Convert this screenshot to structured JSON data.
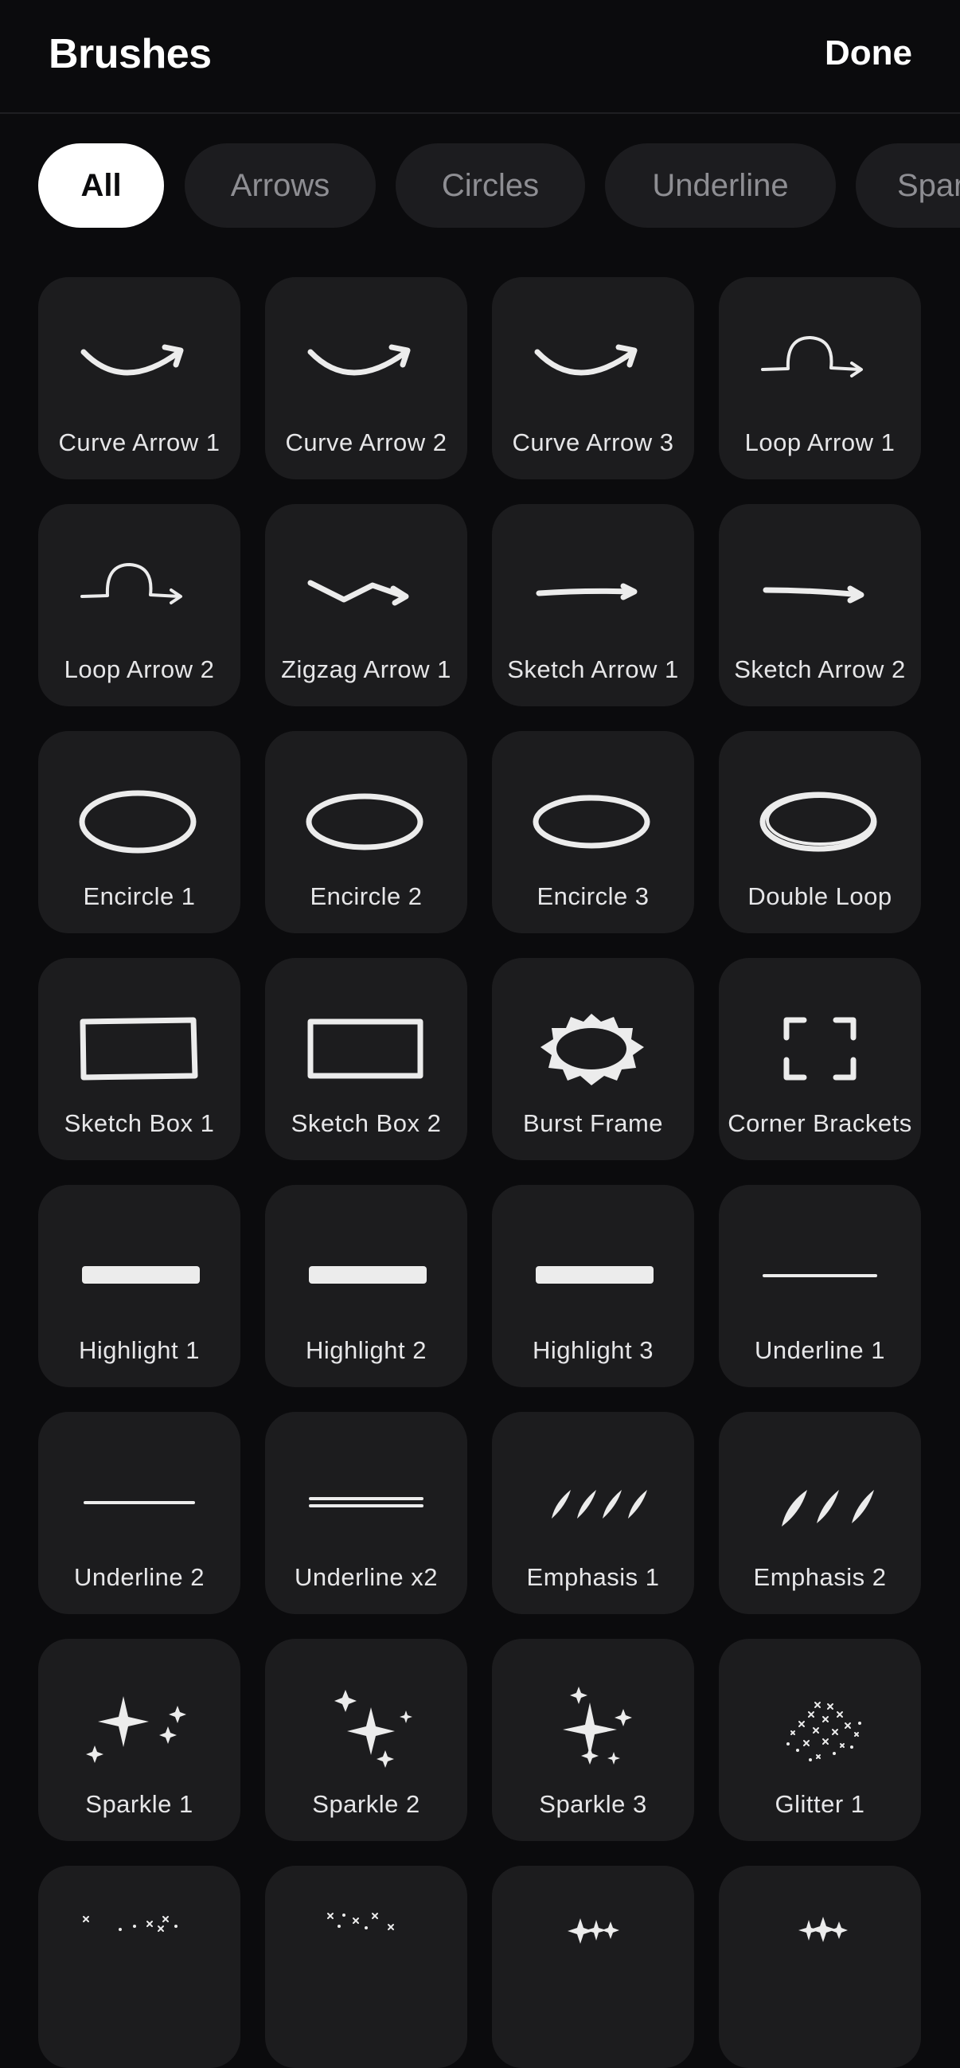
{
  "header": {
    "title": "Brushes",
    "done_label": "Done"
  },
  "filters": [
    {
      "label": "All",
      "active": true
    },
    {
      "label": "Arrows",
      "active": false
    },
    {
      "label": "Circles",
      "active": false
    },
    {
      "label": "Underline",
      "active": false
    },
    {
      "label": "Sparkles",
      "active": false
    }
  ],
  "brushes": [
    {
      "label": "Curve Arrow 1",
      "icon": "curve-arrow-icon"
    },
    {
      "label": "Curve Arrow 2",
      "icon": "curve-arrow-icon"
    },
    {
      "label": "Curve Arrow 3",
      "icon": "curve-arrow-icon"
    },
    {
      "label": "Loop Arrow 1",
      "icon": "loop-arrow-icon"
    },
    {
      "label": "Loop Arrow 2",
      "icon": "loop-arrow-icon"
    },
    {
      "label": "Zigzag Arrow 1",
      "icon": "zigzag-arrow-icon"
    },
    {
      "label": "Sketch Arrow 1",
      "icon": "sketch-arrow-icon"
    },
    {
      "label": "Sketch Arrow 2",
      "icon": "sketch-arrow-icon"
    },
    {
      "label": "Encircle 1",
      "icon": "encircle-icon"
    },
    {
      "label": "Encircle 2",
      "icon": "encircle-icon"
    },
    {
      "label": "Encircle 3",
      "icon": "encircle-icon"
    },
    {
      "label": "Double Loop",
      "icon": "double-loop-icon"
    },
    {
      "label": "Sketch Box 1",
      "icon": "sketch-box-icon"
    },
    {
      "label": "Sketch Box 2",
      "icon": "sketch-box-icon"
    },
    {
      "label": "Burst Frame",
      "icon": "burst-frame-icon"
    },
    {
      "label": "Corner Brackets",
      "icon": "corner-brackets-icon"
    },
    {
      "label": "Highlight 1",
      "icon": "highlight-icon"
    },
    {
      "label": "Highlight 2",
      "icon": "highlight-icon"
    },
    {
      "label": "Highlight 3",
      "icon": "highlight-icon"
    },
    {
      "label": "Underline 1",
      "icon": "underline-icon"
    },
    {
      "label": "Underline 2",
      "icon": "underline-icon"
    },
    {
      "label": "Underline x2",
      "icon": "double-underline-icon"
    },
    {
      "label": "Emphasis 1",
      "icon": "emphasis-icon"
    },
    {
      "label": "Emphasis 2",
      "icon": "emphasis-icon"
    },
    {
      "label": "Sparkle 1",
      "icon": "sparkle-icon"
    },
    {
      "label": "Sparkle 2",
      "icon": "sparkle-icon"
    },
    {
      "label": "Sparkle 3",
      "icon": "sparkle-icon"
    },
    {
      "label": "Glitter 1",
      "icon": "glitter-icon"
    },
    {
      "label": "",
      "icon": "glitter-icon"
    },
    {
      "label": "",
      "icon": "glitter-icon"
    },
    {
      "label": "",
      "icon": "sparkle-row-icon"
    },
    {
      "label": "",
      "icon": "sparkle-row-icon"
    }
  ]
}
